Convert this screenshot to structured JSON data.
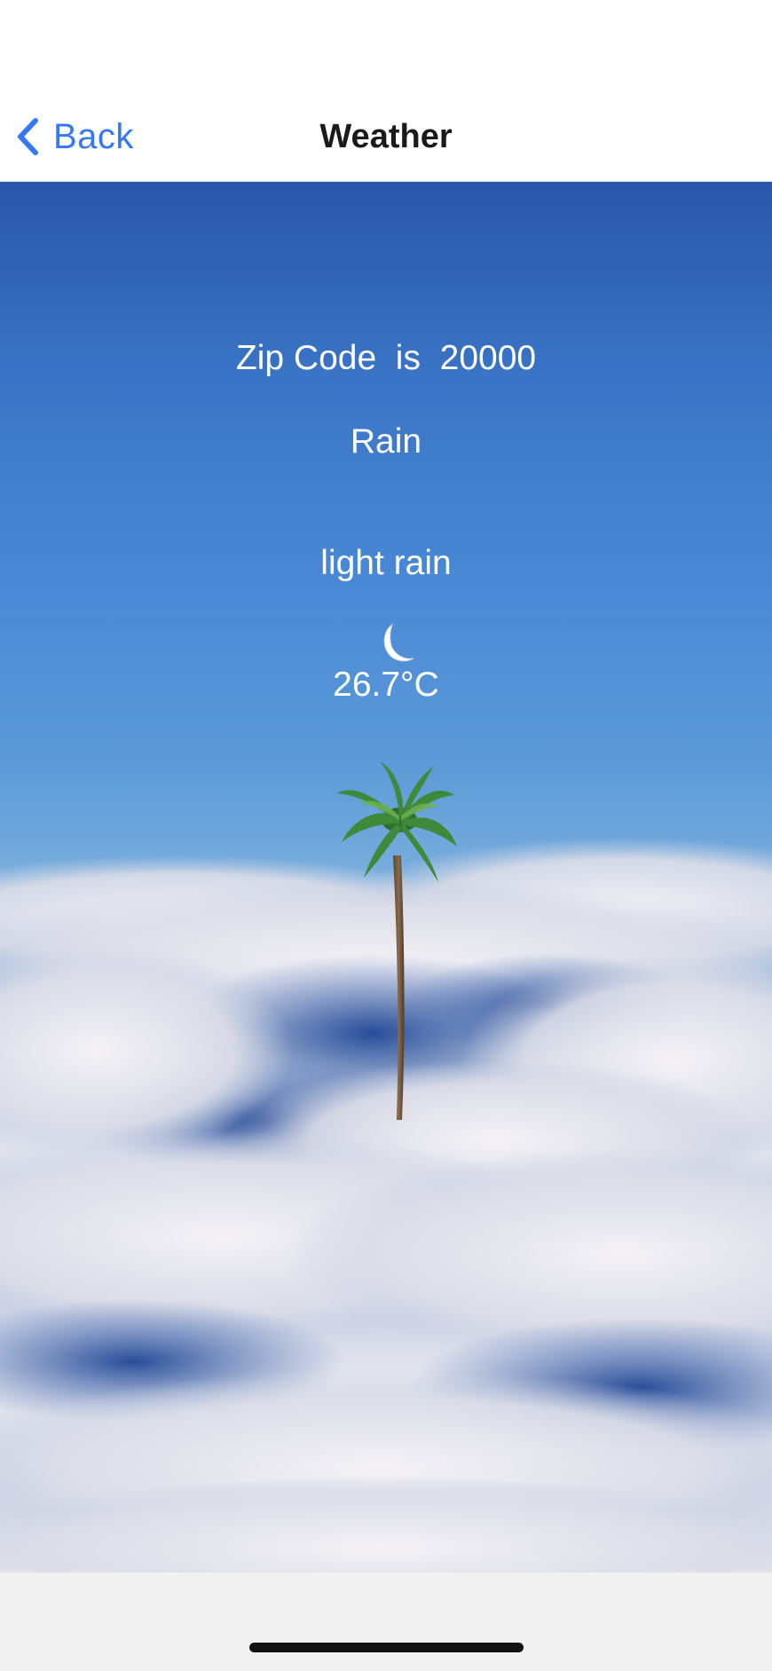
{
  "nav": {
    "back_label": "Back",
    "title": "Weather"
  },
  "weather": {
    "zip_line": "Zip Code  is  20000",
    "main": "Rain",
    "description": "light rain",
    "icon": "crescent-moon-icon",
    "temperature": "26.7°C"
  },
  "colors": {
    "accent": "#3478f6",
    "title_text": "#1a1a1a",
    "overlay_text": "#ffffff",
    "sky_top": "#2a56a8",
    "sky_bottom": "#79aedd"
  }
}
